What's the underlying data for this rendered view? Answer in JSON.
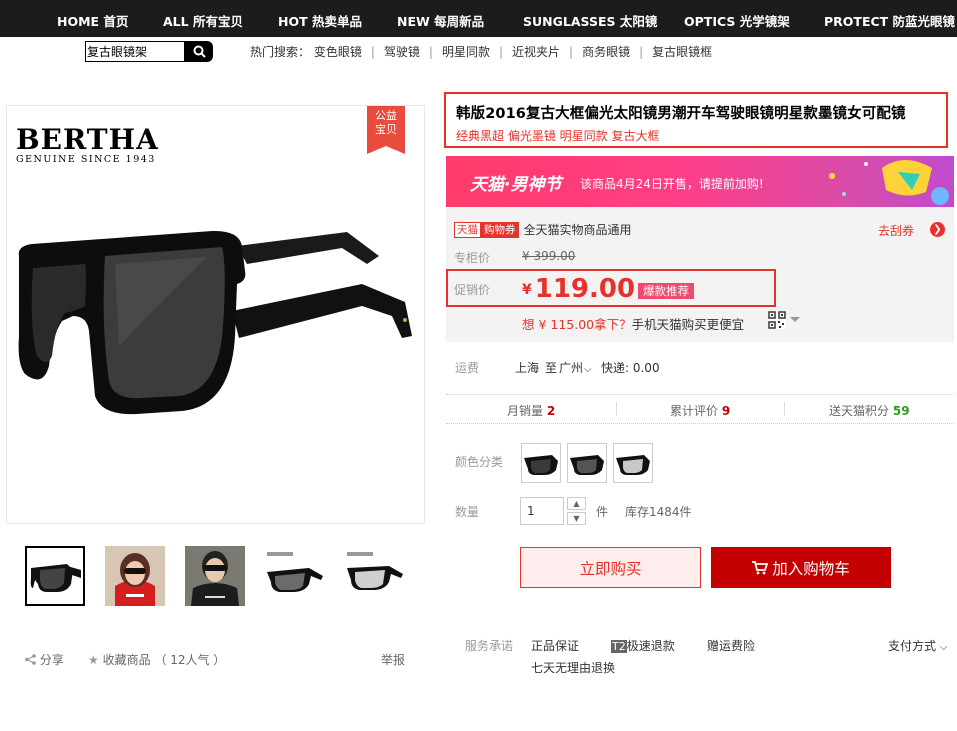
{
  "nav": [
    "HOME 首页",
    "ALL 所有宝贝",
    "HOT 热卖单品",
    "NEW 每周新品",
    "SUNGLASSES 太阳镜",
    "OPTICS 光学镜架",
    "PROTECT 防蓝光眼镜"
  ],
  "search": {
    "value": "复古眼镜架"
  },
  "hot_search": {
    "label": "热门搜索：",
    "terms": [
      "变色眼镜",
      "驾驶镜",
      "明星同款",
      "近视夹片",
      "商务眼镜",
      "复古眼镜框"
    ]
  },
  "brand": {
    "name": "BERTHA",
    "subtitle": "GENUINE SINCE 1943",
    "badge": "公益宝贝"
  },
  "share": {
    "share": "分享",
    "favorite": "收藏商品",
    "popularity": "（ 12人气 ）",
    "report": "举报"
  },
  "product": {
    "title": "韩版2016复古大框偏光太阳镜男潮开车驾驶眼镜明星款墨镜女可配镜",
    "subtitle": "经典黑超 偏光墨镜 明星同款 复古大框"
  },
  "banner": {
    "brand": "天猫·男神节",
    "notice": "该商品4月24日开售，请提前加购!"
  },
  "coupon": {
    "tag1": "天猫",
    "tag2": "购物券",
    "text": "全天猫实物商品通用",
    "link": "去刮券"
  },
  "price": {
    "original_label": "专柜价",
    "original": "¥ 399.00",
    "promo_label": "促销价",
    "currency": "¥",
    "promo": "119.00",
    "hot_tag": "爆款推荐",
    "mobile_red": "想 ¥ 115.00拿下？",
    "mobile_rest": "手机天猫购买更便宜"
  },
  "shipping": {
    "label": "运费",
    "from": "上海",
    "to_word": "至",
    "city": "广州",
    "fee": "快递: 0.00"
  },
  "stats": {
    "sales_label": "月销量",
    "sales": "2",
    "reviews_label": "累计评价",
    "reviews": "9",
    "points_label": "送天猫积分",
    "points": "59"
  },
  "color": {
    "label": "颜色分类"
  },
  "quantity": {
    "label": "数量",
    "value": "1",
    "unit": "件",
    "stock": "库存1484件"
  },
  "actions": {
    "buy": "立即购买",
    "cart": "加入购物车"
  },
  "service": {
    "label": "服务承诺",
    "items": [
      "正品保证",
      "极速退款",
      "赠运费险",
      "七天无理由退换"
    ],
    "t2_badge": "T2",
    "payment": "支付方式"
  },
  "colors": {
    "accent": "#e5332a",
    "cart": "#c40000",
    "green": "#2e9b1c"
  }
}
